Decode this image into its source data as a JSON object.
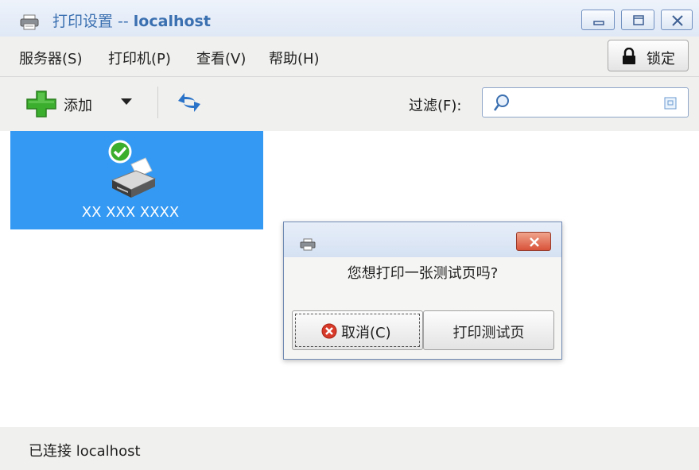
{
  "window": {
    "title_prefix": "打印设置 -- ",
    "title_host": "localhost",
    "icon": "printer-icon",
    "controls": [
      "minimize-icon",
      "maximize-icon",
      "close-icon"
    ]
  },
  "menubar": {
    "items": [
      {
        "label": "服务器(S)"
      },
      {
        "label": "打印机(P)"
      },
      {
        "label": "查看(V)"
      },
      {
        "label": "帮助(H)"
      }
    ],
    "lock_label": "锁定"
  },
  "toolbar": {
    "add_label": "添加",
    "filter_label": "过滤(F):",
    "filter_value": ""
  },
  "printers": [
    {
      "name": "XX XXX XXXX",
      "status": "ready",
      "selected": true
    }
  ],
  "dialog": {
    "message": "您想打印一张测试页吗?",
    "cancel_label": "取消(C)",
    "print_label": "打印测试页"
  },
  "statusbar": {
    "text": "已连接 localhost"
  },
  "colors": {
    "selection": "#3399f3",
    "title_text": "#3a6fb0",
    "add_green": "#3cae2e",
    "refresh_blue": "#2a73c9"
  }
}
